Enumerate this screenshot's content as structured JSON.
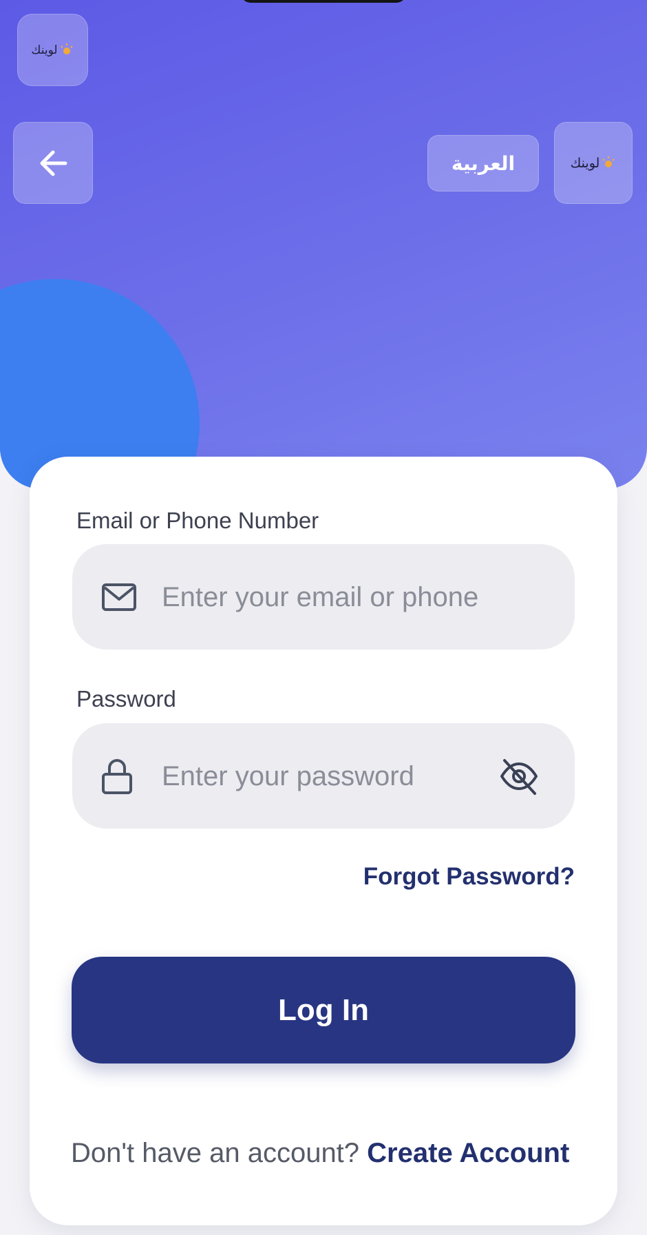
{
  "header": {
    "logo_text": "لوينك",
    "language_toggle": "العربية"
  },
  "form": {
    "email": {
      "label": "Email or Phone Number",
      "placeholder": "Enter your email or phone",
      "icon": "mail-icon"
    },
    "password": {
      "label": "Password",
      "placeholder": "Enter your password",
      "icon": "lock-icon",
      "toggle_icon": "eye-off-icon"
    },
    "forgot_password": "Forgot Password?",
    "login_button": "Log In",
    "signup_prompt": "Don't have an account?",
    "signup_link": "Create Account"
  },
  "colors": {
    "hero_gradient_start": "#5d5ae6",
    "hero_gradient_end": "#7a82ee",
    "accent_circle": "#3d7ff0",
    "primary_button": "#283583",
    "link": "#23306f"
  }
}
